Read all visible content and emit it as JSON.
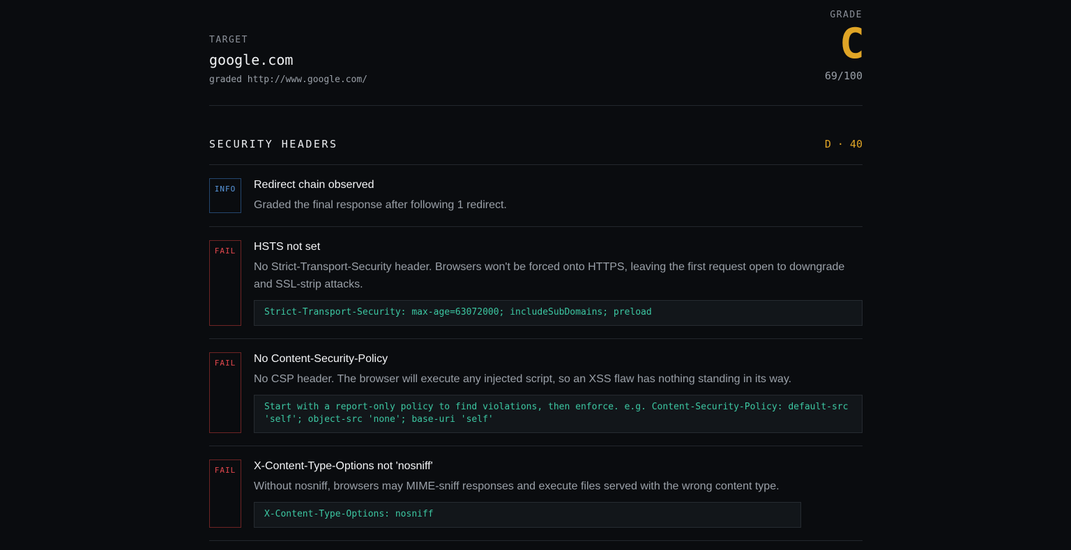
{
  "target": {
    "label": "TARGET",
    "host": "google.com",
    "graded": "graded http://www.google.com/"
  },
  "grade": {
    "label": "GRADE",
    "letter": "C",
    "score": "69/100",
    "color": "#e0a526"
  },
  "section": {
    "title": "SECURITY HEADERS",
    "grade": "D · 40"
  },
  "findings": [
    {
      "status": "INFO",
      "title": "Redirect chain observed",
      "description": "Graded the final response after following 1 redirect.",
      "fix": ""
    },
    {
      "status": "FAIL",
      "title": "HSTS not set",
      "description": "No Strict-Transport-Security header. Browsers won't be forced onto HTTPS, leaving the first request open to downgrade and SSL-strip attacks.",
      "fix": "Strict-Transport-Security: max-age=63072000; includeSubDomains; preload"
    },
    {
      "status": "FAIL",
      "title": "No Content-Security-Policy",
      "description": "No CSP header. The browser will execute any injected script, so an XSS flaw has nothing standing in its way.",
      "fix": "Start with a report-only policy to find violations, then enforce. e.g. Content-Security-Policy: default-src 'self'; object-src 'none'; base-uri 'self'"
    },
    {
      "status": "FAIL",
      "title": "X-Content-Type-Options not 'nosniff'",
      "description": "Without nosniff, browsers may MIME-sniff responses and execute files served with the wrong content type.",
      "fix": "X-Content-Type-Options: nosniff"
    }
  ],
  "colors": {
    "background": "#0a0c0f",
    "fail": "#e5484d",
    "info": "#5a98de",
    "fix_text": "#3cc7a2"
  }
}
